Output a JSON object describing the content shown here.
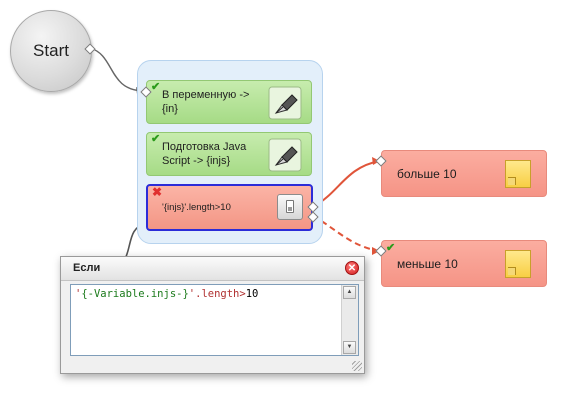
{
  "start_node": {
    "label": "Start"
  },
  "steps": [
    {
      "label": "В переменную -> {in}",
      "status": "ok"
    },
    {
      "label": "Подготовка Java Script -> {injs}",
      "status": "ok"
    }
  ],
  "condition": {
    "label": "'{injs}'.length>10",
    "status": "error"
  },
  "outcomes": [
    {
      "label": "больше 10"
    },
    {
      "label": "меньше 10",
      "status": "ok"
    }
  ],
  "dialog": {
    "title": "Если",
    "code": {
      "prefix": "'",
      "variable": "{-Variable.injs-}",
      "middle": "'.length>",
      "number": "10"
    }
  },
  "colors": {
    "step_fill": "#a6db86",
    "condition_fill": "#f39685",
    "condition_border": "#2c2cd8",
    "outcome_fill": "#f59486",
    "wire_true": "#e0553a",
    "wire_false": "#e0553a",
    "wire_default": "#555555"
  }
}
